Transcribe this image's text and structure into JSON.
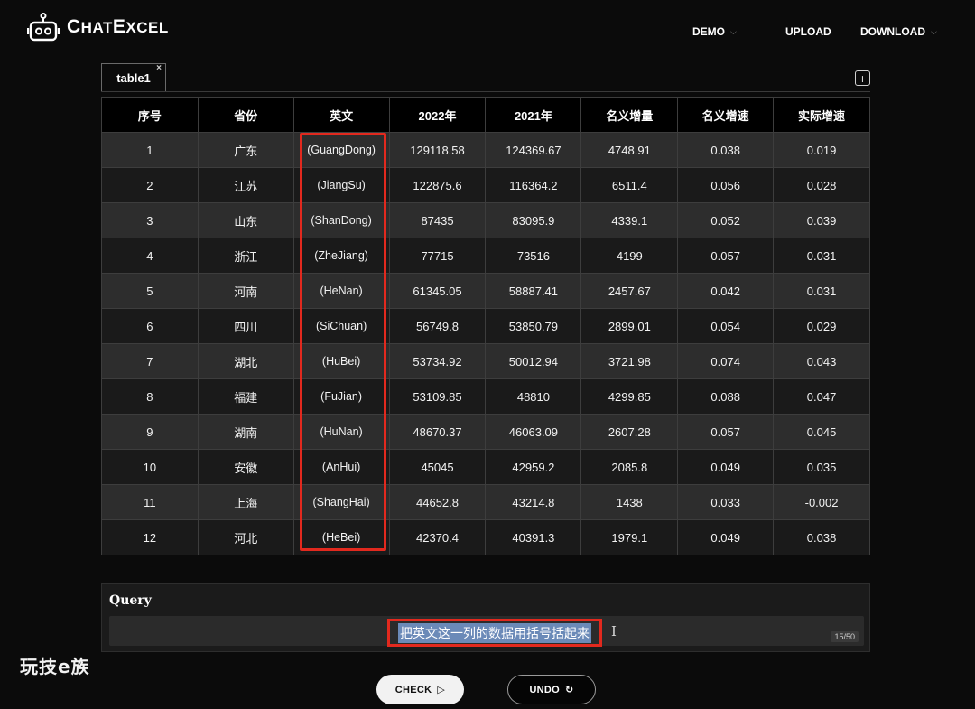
{
  "app": {
    "logo_big": "C",
    "logo_rest_1": "HAT",
    "logo_big_2": "E",
    "logo_rest_2": "XCEL"
  },
  "nav": {
    "demo": "DEMO",
    "upload": "UPLOAD",
    "download": "DOWNLOAD"
  },
  "tabs": [
    {
      "label": "table1",
      "close": "×"
    }
  ],
  "add_tab": "+",
  "table": {
    "headers": [
      "序号",
      "省份",
      "英文",
      "2022年",
      "2021年",
      "名义增量",
      "名义增速",
      "实际增速"
    ],
    "rows": [
      [
        "1",
        "广东",
        "(GuangDong)",
        "129118.58",
        "124369.67",
        "4748.91",
        "0.038",
        "0.019"
      ],
      [
        "2",
        "江苏",
        "(JiangSu)",
        "122875.6",
        "116364.2",
        "6511.4",
        "0.056",
        "0.028"
      ],
      [
        "3",
        "山东",
        "(ShanDong)",
        "87435",
        "83095.9",
        "4339.1",
        "0.052",
        "0.039"
      ],
      [
        "4",
        "浙江",
        "(ZheJiang)",
        "77715",
        "73516",
        "4199",
        "0.057",
        "0.031"
      ],
      [
        "5",
        "河南",
        "(HeNan)",
        "61345.05",
        "58887.41",
        "2457.67",
        "0.042",
        "0.031"
      ],
      [
        "6",
        "四川",
        "(SiChuan)",
        "56749.8",
        "53850.79",
        "2899.01",
        "0.054",
        "0.029"
      ],
      [
        "7",
        "湖北",
        "(HuBei)",
        "53734.92",
        "50012.94",
        "3721.98",
        "0.074",
        "0.043"
      ],
      [
        "8",
        "福建",
        "(FuJian)",
        "53109.85",
        "48810",
        "4299.85",
        "0.088",
        "0.047"
      ],
      [
        "9",
        "湖南",
        "(HuNan)",
        "48670.37",
        "46063.09",
        "2607.28",
        "0.057",
        "0.045"
      ],
      [
        "10",
        "安徽",
        "(AnHui)",
        "45045",
        "42959.2",
        "2085.8",
        "0.049",
        "0.035"
      ],
      [
        "11",
        "上海",
        "(ShangHai)",
        "44652.8",
        "43214.8",
        "1438",
        "0.033",
        "-0.002"
      ],
      [
        "12",
        "河北",
        "(HeBei)",
        "42370.4",
        "40391.3",
        "1979.1",
        "0.049",
        "0.038"
      ]
    ]
  },
  "query": {
    "label": "Query",
    "value": "把英文这一列的数据用括号括起来",
    "count": "15/50"
  },
  "buttons": {
    "check": "CHECK",
    "check_icon": "▷",
    "undo": "UNDO",
    "undo_icon": "↻"
  },
  "watermark": "玩技e族",
  "colors": {
    "background": "#0b0b0b",
    "row_odd": "#2d2d2d",
    "row_even": "#1a1a1a",
    "highlight": "#e2291e",
    "selection": "#6b8ab8"
  }
}
